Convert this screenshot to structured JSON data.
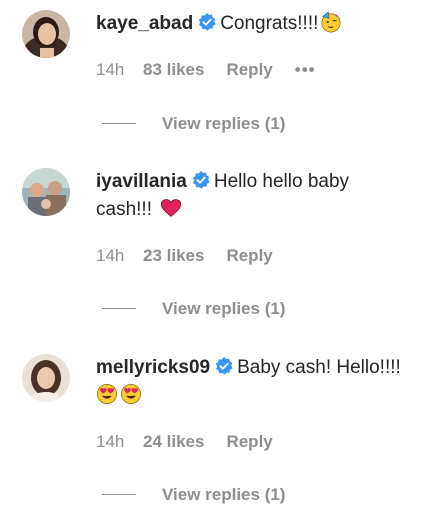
{
  "comments": [
    {
      "username": "kaye_abad",
      "verified": true,
      "text_line1": "Congrats!!!!",
      "text_line2": "",
      "emoji_line1": [
        "partying-face"
      ],
      "emoji_line2": [],
      "time": "14h",
      "likes": "83 likes",
      "reply_label": "Reply",
      "more_label": "•••",
      "view_replies": "View replies (1)"
    },
    {
      "username": "iyavillania",
      "verified": true,
      "text_line1": "Hello hello baby",
      "text_line2": "cash!!!",
      "emoji_line1": [],
      "emoji_line2": [
        "red-heart"
      ],
      "time": "14h",
      "likes": "23 likes",
      "reply_label": "Reply",
      "view_replies": "View replies (1)"
    },
    {
      "username": "mellyricks09",
      "verified": true,
      "text_line1": "Baby cash! Hello!!!!",
      "text_line2": "",
      "emoji_line1": [],
      "emoji_line2": [
        "heart-eyes",
        "heart-eyes"
      ],
      "time": "14h",
      "likes": "24 likes",
      "reply_label": "Reply",
      "view_replies": "View replies (1)"
    }
  ],
  "colors": {
    "text": "#262626",
    "muted": "#8e8e8e",
    "verified": "#3897f0",
    "heart": "#e0245e"
  }
}
